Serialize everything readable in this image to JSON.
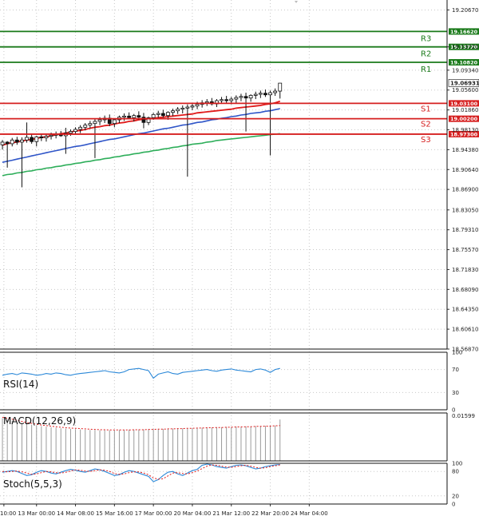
{
  "chart_data": {
    "type": "candlestick",
    "y_ticks": [
      "19.20670",
      "19.13720",
      "19.09340",
      "19.05600",
      "19.01860",
      "18.98130",
      "18.94380",
      "18.90640",
      "18.86900",
      "18.83050",
      "18.79310",
      "18.75570",
      "18.71830",
      "18.68090",
      "18.64350",
      "18.60610",
      "18.56870"
    ],
    "ylim": [
      18.5687,
      19.2254
    ],
    "x_ticks": [
      {
        "x": 0.3,
        "label": "10:00"
      },
      {
        "x": 7,
        "label": "13 Mar 00:00"
      },
      {
        "x": 15,
        "label": "14 Mar 08:00"
      },
      {
        "x": 23,
        "label": "15 Mar 16:00"
      },
      {
        "x": 31,
        "label": "17 Mar 00:00"
      },
      {
        "x": 39,
        "label": "20 Mar 04:00"
      },
      {
        "x": 47,
        "label": "21 Mar 12:00"
      },
      {
        "x": 55,
        "label": "22 Mar 20:00"
      },
      {
        "x": 63,
        "label": "24 Mar 04:00"
      }
    ],
    "current_price": "19.06931",
    "levels": [
      {
        "name": "R3",
        "price": 19.1662,
        "label": "19.16620",
        "color": "#1a7a1a"
      },
      {
        "name": "R2",
        "price": 19.1372,
        "label": "19.13720",
        "color": "#1a7a1a"
      },
      {
        "name": "R1",
        "price": 19.1082,
        "label": "19.10820",
        "color": "#1a7a1a"
      },
      {
        "name": "S1",
        "price": 19.031,
        "label": "19.03100",
        "color": "#d61f1f"
      },
      {
        "name": "S2",
        "price": 19.002,
        "label": "19.00200",
        "color": "#d61f1f"
      },
      {
        "name": "S3",
        "price": 18.973,
        "label": "18.97300",
        "color": "#d61f1f"
      }
    ],
    "candles": [
      [
        18.953,
        18.962,
        18.944,
        18.958
      ],
      [
        18.958,
        18.96,
        18.91,
        18.955
      ],
      [
        18.955,
        18.966,
        18.95,
        18.962
      ],
      [
        18.962,
        18.968,
        18.953,
        18.958
      ],
      [
        18.958,
        18.967,
        18.873,
        18.962
      ],
      [
        18.962,
        18.995,
        18.957,
        18.967
      ],
      [
        18.967,
        18.973,
        18.955,
        18.959
      ],
      [
        18.959,
        18.97,
        18.95,
        18.968
      ],
      [
        18.968,
        18.974,
        18.96,
        18.966
      ],
      [
        18.966,
        18.972,
        18.959,
        18.969
      ],
      [
        18.969,
        18.976,
        18.963,
        18.971
      ],
      [
        18.971,
        18.978,
        18.965,
        18.973
      ],
      [
        18.973,
        18.979,
        18.968,
        18.97
      ],
      [
        18.97,
        18.985,
        18.936,
        18.975
      ],
      [
        18.975,
        18.982,
        18.97,
        18.978
      ],
      [
        18.978,
        18.986,
        18.972,
        18.982
      ],
      [
        18.982,
        18.99,
        18.975,
        18.986
      ],
      [
        18.986,
        18.994,
        18.98,
        18.99
      ],
      [
        18.99,
        18.998,
        18.984,
        18.993
      ],
      [
        18.993,
        19.002,
        18.928,
        18.997
      ],
      [
        18.997,
        19.005,
        18.99,
        19.0
      ],
      [
        19.0,
        19.008,
        18.994,
        19.003
      ],
      [
        19.003,
        19.01,
        18.988,
        18.993
      ],
      [
        18.993,
        19.002,
        18.986,
        19.0
      ],
      [
        19.0,
        19.008,
        18.994,
        19.005
      ],
      [
        19.005,
        19.012,
        18.998,
        19.007
      ],
      [
        19.007,
        19.014,
        19.001,
        19.004
      ],
      [
        19.004,
        19.011,
        18.997,
        19.008
      ],
      [
        19.008,
        19.016,
        19.0,
        19.005
      ],
      [
        19.005,
        19.013,
        18.984,
        18.995
      ],
      [
        18.995,
        19.006,
        18.99,
        19.004
      ],
      [
        19.004,
        19.013,
        19.0,
        19.01
      ],
      [
        19.01,
        19.017,
        19.004,
        19.012
      ],
      [
        19.012,
        19.019,
        19.004,
        19.008
      ],
      [
        19.008,
        19.016,
        19.0,
        19.014
      ],
      [
        19.014,
        19.021,
        19.007,
        19.017
      ],
      [
        19.017,
        19.024,
        19.011,
        19.02
      ],
      [
        19.02,
        19.027,
        19.012,
        19.022
      ],
      [
        19.022,
        19.029,
        18.893,
        19.024
      ],
      [
        19.024,
        19.031,
        19.018,
        19.026
      ],
      [
        19.026,
        19.034,
        19.02,
        19.029
      ],
      [
        19.029,
        19.037,
        19.023,
        19.032
      ],
      [
        19.032,
        19.039,
        19.026,
        19.034
      ],
      [
        19.034,
        19.041,
        19.027,
        19.03
      ],
      [
        19.03,
        19.039,
        19.024,
        19.036
      ],
      [
        19.036,
        19.043,
        19.03,
        19.038
      ],
      [
        19.038,
        19.045,
        19.032,
        19.036
      ],
      [
        19.036,
        19.043,
        19.029,
        19.039
      ],
      [
        19.039,
        19.046,
        19.032,
        19.042
      ],
      [
        19.042,
        19.049,
        19.035,
        19.044
      ],
      [
        19.044,
        19.051,
        18.978,
        19.041
      ],
      [
        19.041,
        19.048,
        19.034,
        19.046
      ],
      [
        19.046,
        19.053,
        19.039,
        19.048
      ],
      [
        19.048,
        19.055,
        19.041,
        19.05
      ],
      [
        19.05,
        19.057,
        19.043,
        19.047
      ],
      [
        19.047,
        19.055,
        18.933,
        19.051
      ],
      [
        19.051,
        19.059,
        19.045,
        19.054
      ],
      [
        19.054,
        19.062,
        19.04,
        19.069
      ]
    ],
    "ma_red": [
      18.952,
      18.955,
      18.957,
      18.958,
      18.96,
      18.962,
      18.963,
      18.965,
      18.967,
      18.968,
      18.97,
      18.972,
      18.974,
      18.975,
      18.977,
      18.979,
      18.98,
      18.982,
      18.984,
      18.986,
      18.987,
      18.989,
      18.99,
      18.992,
      18.994,
      18.995,
      18.997,
      18.998,
      19.0,
      19.001,
      19.002,
      19.003,
      19.004,
      19.005,
      19.006,
      19.007,
      19.008,
      19.009,
      19.01,
      19.011,
      19.013,
      19.014,
      19.015,
      19.016,
      19.017,
      19.018,
      19.019,
      19.02,
      19.022,
      19.023,
      19.024,
      19.025,
      19.026,
      19.027,
      19.029,
      19.03,
      19.032,
      19.035
    ],
    "ma_blue": [
      18.92,
      18.922,
      18.924,
      18.926,
      18.928,
      18.93,
      18.932,
      18.934,
      18.936,
      18.938,
      18.94,
      18.942,
      18.944,
      18.946,
      18.948,
      18.95,
      18.951,
      18.953,
      18.955,
      18.957,
      18.959,
      18.961,
      18.963,
      18.964,
      18.966,
      18.968,
      18.97,
      18.972,
      18.974,
      18.975,
      18.977,
      18.979,
      18.981,
      18.983,
      18.984,
      18.986,
      18.988,
      18.99,
      18.991,
      18.993,
      18.995,
      18.996,
      18.998,
      19.0,
      19.001,
      19.003,
      19.004,
      19.006,
      19.007,
      19.009,
      19.01,
      19.012,
      19.013,
      19.014,
      19.016,
      19.017,
      19.019,
      19.021
    ],
    "ma_green": [
      18.895,
      18.897,
      18.898,
      18.9,
      18.901,
      18.903,
      18.904,
      18.906,
      18.907,
      18.909,
      18.91,
      18.912,
      18.913,
      18.915,
      18.916,
      18.918,
      18.919,
      18.921,
      18.922,
      18.924,
      18.925,
      18.927,
      18.928,
      18.93,
      18.931,
      18.933,
      18.934,
      18.936,
      18.937,
      18.939,
      18.94,
      18.942,
      18.943,
      18.945,
      18.946,
      18.948,
      18.949,
      18.951,
      18.952,
      18.954,
      18.955,
      18.956,
      18.958,
      18.959,
      18.961,
      18.962,
      18.963,
      18.964,
      18.965,
      18.966,
      18.967,
      18.968,
      18.969,
      18.97,
      18.971,
      18.972,
      18.973,
      18.974
    ],
    "rsi": {
      "label": "RSI(14)",
      "ticks": [
        "100",
        "70",
        "30",
        "0"
      ],
      "values": [
        60,
        62,
        63,
        61,
        64,
        63,
        62,
        60,
        61,
        63,
        62,
        64,
        63,
        61,
        60,
        62,
        63,
        64,
        65,
        66,
        67,
        68,
        66,
        65,
        64,
        66,
        70,
        71,
        72,
        70,
        68,
        55,
        62,
        64,
        66,
        63,
        62,
        65,
        66,
        67,
        68,
        69,
        70,
        68,
        67,
        69,
        70,
        71,
        69,
        68,
        67,
        66,
        70,
        71,
        69,
        65,
        70,
        72
      ]
    },
    "macd": {
      "label": "MACD(12,26,9)",
      "ticks": [
        "0.01599"
      ],
      "histogram": [
        0.0155,
        0.015,
        0.0145,
        0.014,
        0.0137,
        0.0134,
        0.0131,
        0.0128,
        0.0126,
        0.0124,
        0.0122,
        0.012,
        0.0118,
        0.0117,
        0.0116,
        0.0115,
        0.0114,
        0.0113,
        0.0112,
        0.0112,
        0.0111,
        0.0111,
        0.0111,
        0.0111,
        0.0112,
        0.0112,
        0.0113,
        0.0113,
        0.0114,
        0.0114,
        0.0115,
        0.0115,
        0.0116,
        0.0116,
        0.0117,
        0.0117,
        0.0118,
        0.0118,
        0.0119,
        0.0119,
        0.012,
        0.012,
        0.0121,
        0.0121,
        0.0122,
        0.0122,
        0.0123,
        0.0123,
        0.0124,
        0.0124,
        0.0125,
        0.0125,
        0.0126,
        0.0126,
        0.0127,
        0.0127,
        0.0128,
        0.015
      ],
      "signal": [
        0.0158,
        0.0155,
        0.0151,
        0.0147,
        0.0143,
        0.0139,
        0.0136,
        0.0133,
        0.013,
        0.0128,
        0.0126,
        0.0124,
        0.0122,
        0.012,
        0.0119,
        0.0118,
        0.0117,
        0.0116,
        0.0115,
        0.0114,
        0.0113,
        0.0113,
        0.0112,
        0.0112,
        0.0112,
        0.0112,
        0.0112,
        0.0113,
        0.0113,
        0.0113,
        0.0114,
        0.0114,
        0.0115,
        0.0115,
        0.0116,
        0.0116,
        0.0117,
        0.0117,
        0.0118,
        0.0118,
        0.0119,
        0.0119,
        0.012,
        0.012,
        0.0121,
        0.0121,
        0.0122,
        0.0122,
        0.0123,
        0.0123,
        0.0124,
        0.0124,
        0.0125,
        0.0125,
        0.0126,
        0.0126,
        0.0127,
        0.0128
      ]
    },
    "stoch": {
      "label": "Stoch(5,5,3)",
      "ticks": [
        "100",
        "80",
        "20",
        "0"
      ],
      "main": [
        78,
        80,
        82,
        80,
        75,
        70,
        72,
        78,
        82,
        80,
        76,
        74,
        78,
        82,
        85,
        83,
        80,
        78,
        82,
        86,
        84,
        80,
        75,
        70,
        72,
        78,
        82,
        80,
        76,
        72,
        68,
        55,
        60,
        70,
        78,
        80,
        74,
        70,
        76,
        82,
        85,
        95,
        98,
        96,
        92,
        90,
        88,
        92,
        95,
        96,
        94,
        90,
        86,
        88,
        92,
        94,
        96,
        97
      ],
      "signal": [
        80,
        79,
        80,
        81,
        79,
        76,
        73,
        74,
        77,
        80,
        79,
        77,
        76,
        78,
        81,
        84,
        83,
        81,
        80,
        82,
        84,
        83,
        80,
        75,
        73,
        74,
        77,
        79,
        79,
        76,
        72,
        64,
        61,
        62,
        69,
        76,
        77,
        75,
        74,
        77,
        81,
        87,
        93,
        96,
        95,
        93,
        91,
        90,
        92,
        94,
        95,
        93,
        90,
        88,
        89,
        92,
        94,
        96
      ]
    }
  }
}
